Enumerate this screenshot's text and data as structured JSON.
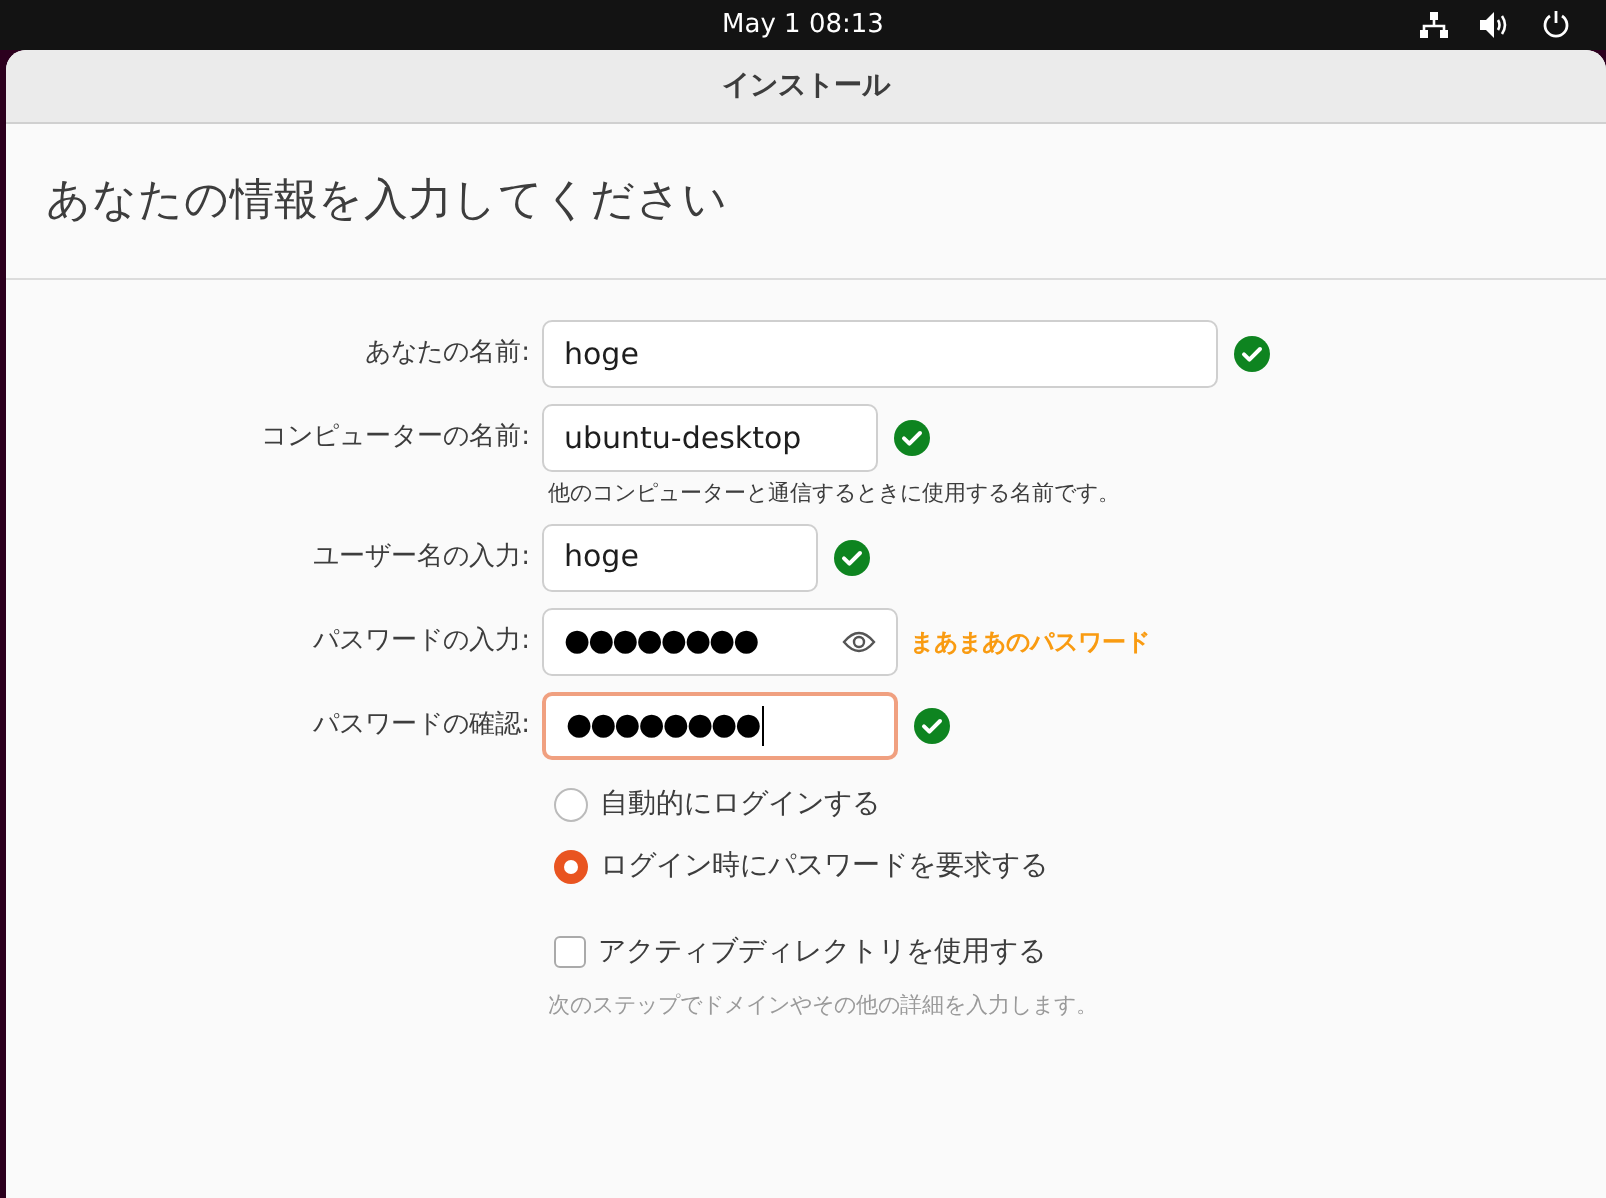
{
  "top_bar": {
    "clock": "May 1  08:13"
  },
  "window": {
    "title": "インストール"
  },
  "heading": "あなたの情報を入力してください",
  "fields": [
    {
      "kind": "text",
      "label": "あなたの名前:",
      "value": "hoge",
      "valid": true,
      "focused": false
    },
    {
      "kind": "text",
      "label": "コンピューターの名前:",
      "value": "ubuntu-desktop",
      "valid": true,
      "focused": false,
      "hint": "他のコンピューターと通信するときに使用する名前です。"
    },
    {
      "kind": "text",
      "label": "ユーザー名の入力:",
      "value": "hoge",
      "valid": true,
      "focused": false
    },
    {
      "kind": "password",
      "label": "パスワードの入力:",
      "value": "●●●●●●●●",
      "valid": false,
      "focused": false,
      "strength": "まあまあのパスワード"
    },
    {
      "kind": "password",
      "label": "パスワードの確認:",
      "value": "●●●●●●●●",
      "valid": true,
      "focused": true
    }
  ],
  "login_options": [
    {
      "label": "自動的にログインする",
      "selected": false
    },
    {
      "label": "ログイン時にパスワードを要求する",
      "selected": true
    }
  ],
  "active_directory": {
    "label": "アクティブディレクトリを使用する",
    "checked": false,
    "hint": "次のステップでドメインやその他の詳細を入力します。"
  }
}
